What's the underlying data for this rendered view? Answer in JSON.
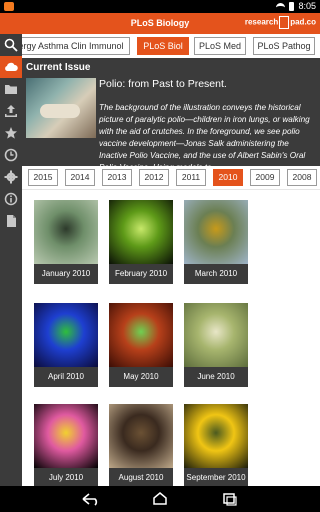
{
  "status": {
    "time": "8:05"
  },
  "appbar": {
    "title": "PLoS Biology",
    "logo_left": "research",
    "logo_right": "pad.co"
  },
  "sidebar": {
    "items": [
      {
        "icon": "search-icon"
      },
      {
        "icon": "cloud-icon"
      },
      {
        "icon": "folder-icon"
      },
      {
        "icon": "upload-icon"
      },
      {
        "icon": "star-icon"
      },
      {
        "icon": "clock-icon"
      },
      {
        "icon": "gear-icon"
      },
      {
        "icon": "info-icon"
      },
      {
        "icon": "document-icon"
      }
    ]
  },
  "journals": {
    "tabs": [
      {
        "label": "ergy Asthma Clin Immunol"
      },
      {
        "label": "PLoS Biol",
        "active": true
      },
      {
        "label": "PLoS Med"
      },
      {
        "label": "PLoS Pathog"
      }
    ]
  },
  "current_issue": {
    "label": "Current Issue",
    "heading": "Polio: from Past to Present.",
    "description": "The background of the illustration conveys the historical picture of paralytic polio—children in iron lungs, or walking with the aid of crutches. In the foreground, we see polio vaccine development—Jonas Salk administering the Inactive Polio Vaccine, and the use of Albert Sabin's Oral Polio Vaccine. Using models to"
  },
  "years": {
    "tabs": [
      {
        "label": "2015"
      },
      {
        "label": "2014"
      },
      {
        "label": "2013"
      },
      {
        "label": "2012"
      },
      {
        "label": "2011"
      },
      {
        "label": "2010",
        "active": true
      },
      {
        "label": "2009"
      },
      {
        "label": "2008"
      }
    ]
  },
  "issues": [
    {
      "caption": "January 2010",
      "colors": [
        "#b9c9b0",
        "#6f8f6a",
        "#2d3a2b"
      ]
    },
    {
      "caption": "February 2010",
      "colors": [
        "#0a0f06",
        "#5e9a18",
        "#c7e86a"
      ]
    },
    {
      "caption": "March 2010",
      "colors": [
        "#9fb4c8",
        "#6b7f53",
        "#c79a1a"
      ]
    },
    {
      "caption": "April 2010",
      "colors": [
        "#0b0b3a",
        "#1e3fd1",
        "#2fbf3b"
      ]
    },
    {
      "caption": "May 2010",
      "colors": [
        "#3b0d05",
        "#b7401a",
        "#6fd052"
      ]
    },
    {
      "caption": "June 2010",
      "colors": [
        "#5d6d3c",
        "#a7b56e",
        "#e8e6c7"
      ]
    },
    {
      "caption": "July 2010",
      "colors": [
        "#000000",
        "#e05aa0",
        "#f1d12f"
      ]
    },
    {
      "caption": "August 2010",
      "colors": [
        "#bfa98a",
        "#3a2a1f",
        "#6b5134"
      ]
    },
    {
      "caption": "September 2010",
      "colors": [
        "#1c1d0b",
        "#f0c514",
        "#4b5a1f"
      ]
    }
  ],
  "colors": {
    "accent": "#e4531c",
    "panel": "#3b3b3b"
  }
}
